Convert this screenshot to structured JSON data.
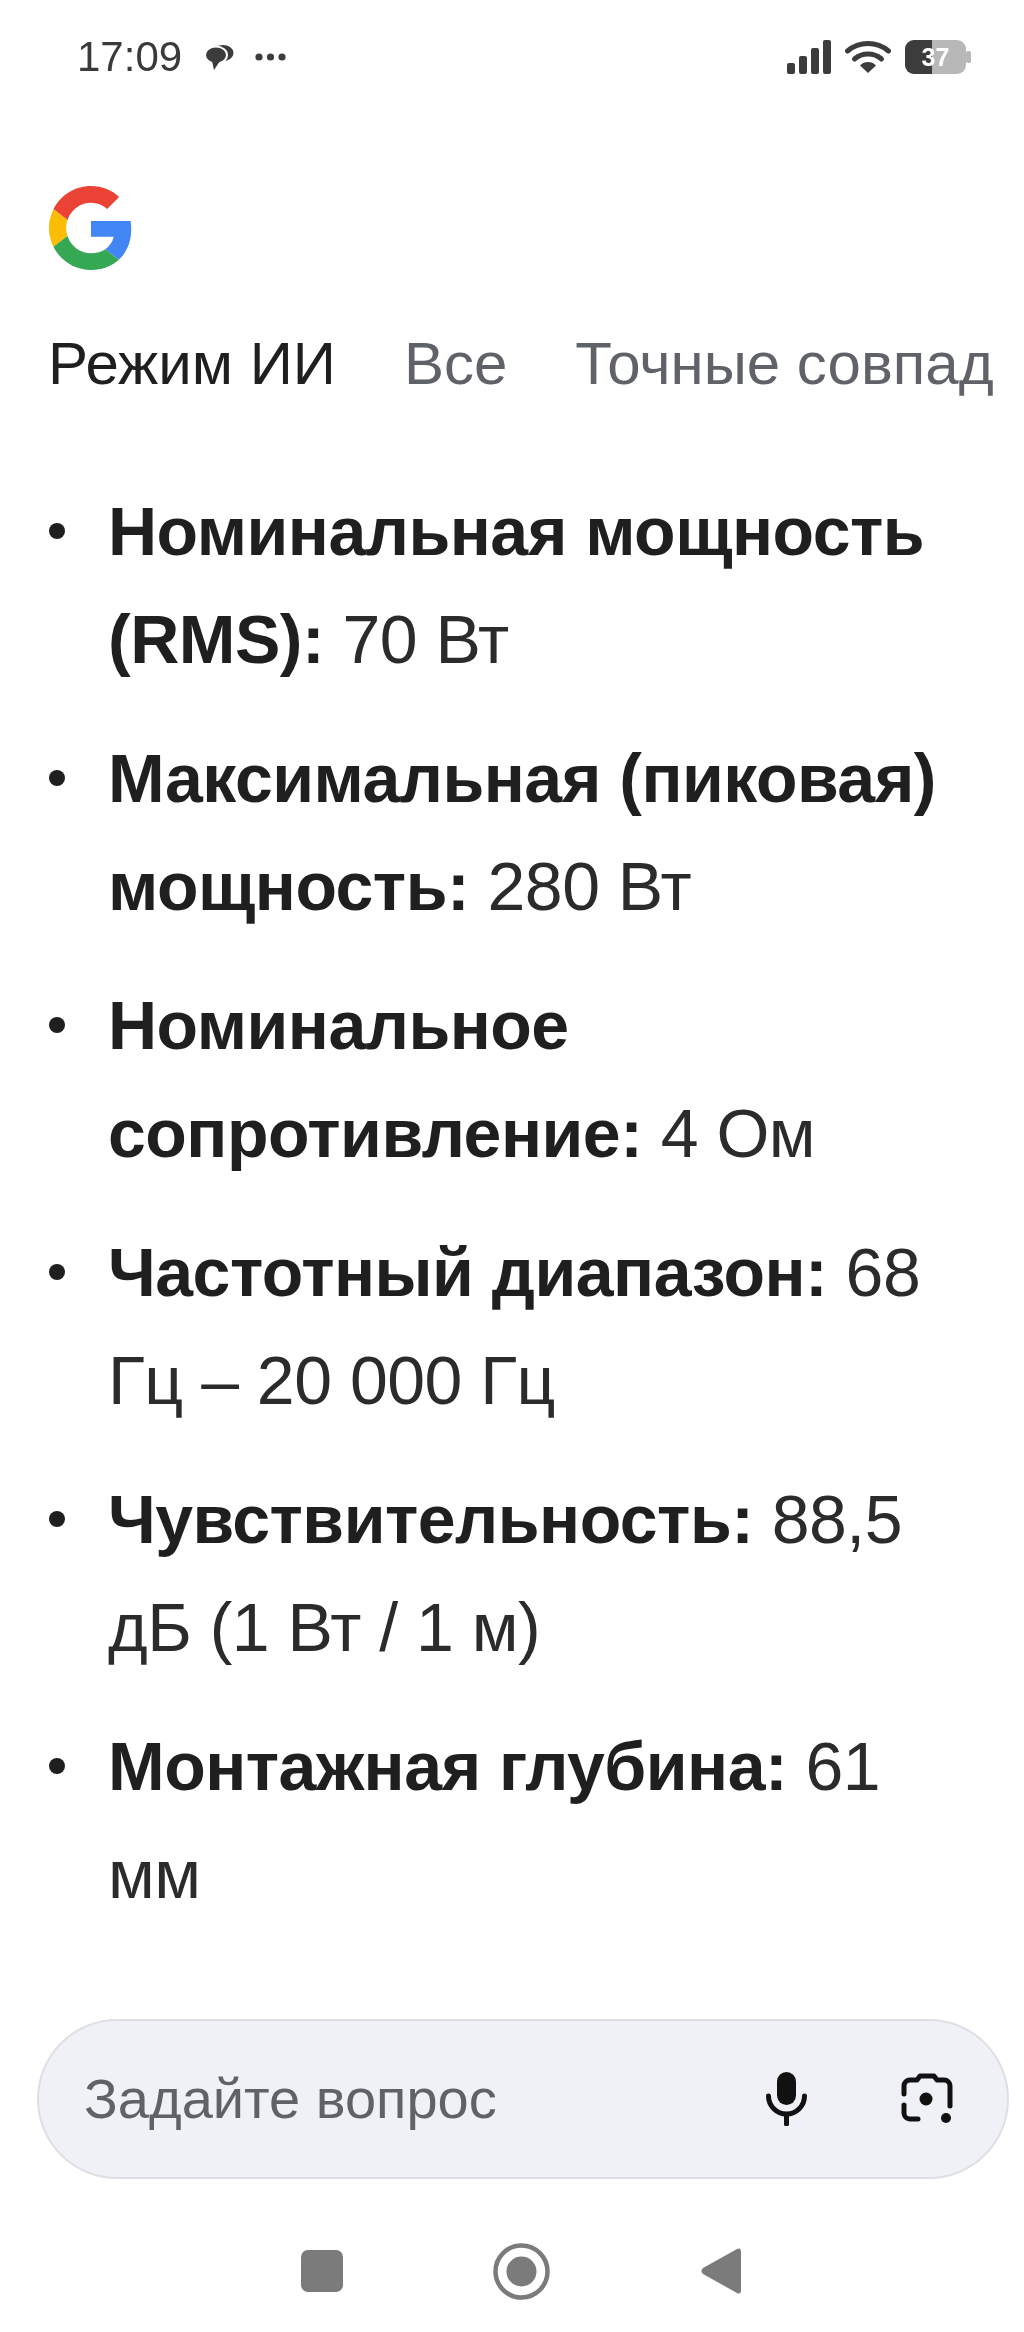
{
  "status_bar": {
    "time": "17:09",
    "battery": "37"
  },
  "tabs": [
    {
      "label": "Режим ИИ",
      "selected": true
    },
    {
      "label": "Все",
      "selected": false
    },
    {
      "label": "Точные совпад",
      "selected": false
    }
  ],
  "answer": {
    "items": [
      "**Номинальная мощность (RMS):** 70 Вт",
      "**Максимальная (пиковая) мощность:** 280 Вт",
      "**Номинальное сопротивление:** 4 Ом",
      "**Частотный диапазон:** 68 Гц – 20 000 Гц",
      "**Чувствительность:** 88,5 дБ (1 Вт / 1 м)",
      "**Монтажная глубина:** 61 мм"
    ]
  },
  "search": {
    "placeholder": "Задайте вопрос"
  }
}
